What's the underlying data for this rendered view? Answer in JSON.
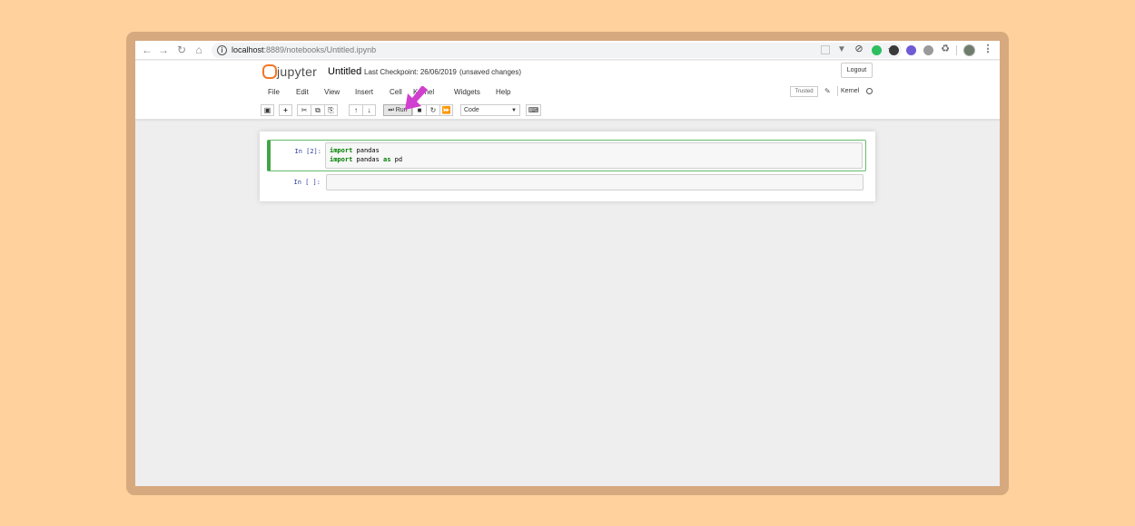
{
  "browser": {
    "url_host": "localhost",
    "url_rest": ":8889/notebooks/Untitled.ipynb"
  },
  "header": {
    "logo_text": "jupyter",
    "notebook_title": "Untitled",
    "checkpoint": "Last Checkpoint: 26/06/2019",
    "autosave": "(unsaved changes)",
    "logout_label": "Logout"
  },
  "menubar": {
    "items": [
      "File",
      "Edit",
      "View",
      "Insert",
      "Cell",
      "Kernel",
      "Widgets",
      "Help"
    ],
    "trusted_label": "Trusted",
    "kernel_label": "Kernel"
  },
  "toolbar": {
    "run_label": "Run",
    "cell_type": "Code"
  },
  "notebook": {
    "cells": [
      {
        "prompt": "In [2]:",
        "lines": [
          {
            "kw": "import",
            "rest": " pandas"
          },
          {
            "kw": "import",
            "rest": " pandas ",
            "kw2": "as",
            "rest2": " pd"
          }
        ],
        "selected": true
      },
      {
        "prompt": "In [ ]:",
        "lines": [],
        "selected": false
      }
    ]
  },
  "colors": {
    "background": "#FFD19C",
    "frame": "#D7A97F",
    "jupyter_orange": "#F37726",
    "selected_cell": "#42A545",
    "keyword": "#008000",
    "annotation_arrow": "#D03FCF"
  }
}
